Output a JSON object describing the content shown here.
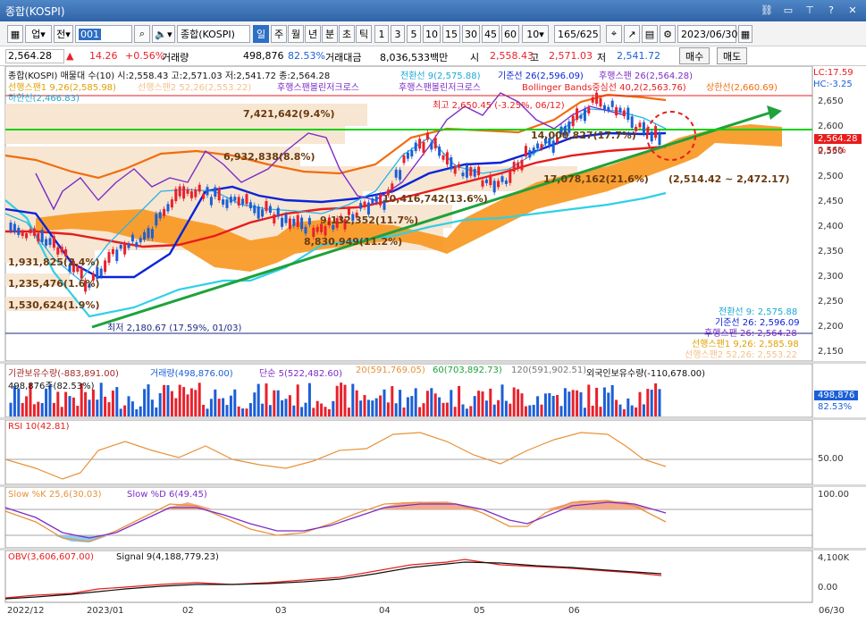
{
  "window": {
    "title": "종합(KOSPI)"
  },
  "toolbar": {
    "num_field": "0",
    "gubun1": "업",
    "gubun2": "전",
    "code": "001",
    "name": "종합(KOSPI)",
    "periods": [
      "일",
      "주",
      "월",
      "년",
      "분",
      "초",
      "틱"
    ],
    "selected_period": "일",
    "intervals": [
      "1",
      "3",
      "5",
      "10",
      "15",
      "30",
      "45",
      "60"
    ],
    "interval_value": "10",
    "count_display": "165",
    "count_total": "/625",
    "date": "2023/06/30"
  },
  "price": {
    "current": "2,564.28",
    "change": "14.26",
    "change_pct": "+0.56%",
    "volume_label": "거래량",
    "volume": "498,876",
    "volume_pct": "82.53%",
    "amount_label": "거래대금",
    "amount": "8,036,533백만",
    "open_label": "시",
    "open": "2,558.43",
    "high_label": "고",
    "high": "2,571.03",
    "low_label": "저",
    "low": "2,541.72",
    "buy": "매수",
    "sell": "매도"
  },
  "main_legend": {
    "line1a": "종합(KOSPI) 매물대 수(10)  시:2,558.43 고:2,571.03 저:2,541.72 종:2,564.28",
    "line1b": "전환선 9(2,575.88)",
    "line1c": "기준선 26(2,596.09)",
    "line1d": "후행스팬 26(2,564.28)",
    "line2a": "선행스팬1 9,26(2,585.98)",
    "line2b": "선행스팬2 52,26(2,553.22)",
    "line2c": "후행스팬볼린저크로스",
    "line2d": "후행스팬볼린저크로스",
    "line2e": "Bollinger Bands중심선 40,2(2,563.76)",
    "line2f": "상한선(2,660.69)",
    "line3": "하한선(2,466.83)",
    "lc": "LC:17.59",
    "hc": "HC:-3.25"
  },
  "annotations": {
    "vp_top": "7,421,642(9.4%)",
    "vp_2": "6,932,838(8.8%)",
    "vp_3": "10,416,742(13.6%)",
    "vp_4": "9,132,352(11.7%)",
    "vp_5": "8,830,949(11.2%)",
    "vp_6": "1,931,825(2.4%)",
    "vp_7": "1,235,476(1.6%)",
    "vp_8": "1,530,624(1.9%)",
    "vp_9": "14,000,827(17.7%)",
    "vp_10": "17,078,162(21.6%)",
    "vp_range": "(2,514.42 ~ 2,472.17)",
    "high": "최고 2,650.45 (-3.25%, 06/12)",
    "low": "최저 2,180.67 (17.59%, 01/03)"
  },
  "right_legend": {
    "a": "전환선 9: 2,575.88",
    "b": "기준선 26: 2,596.09",
    "c": "후행스팬 26: 2,564.28",
    "d": "선행스팬1 9,26: 2,585.98",
    "e": "선행스팬2 52,26: 2,553.22"
  },
  "yaxis": [
    "2,650",
    "2,600",
    "2,550",
    "2,500",
    "2,450",
    "2,400",
    "2,350",
    "2,300",
    "2,250",
    "2,200",
    "2,150"
  ],
  "y_current_tag": "2,564.28",
  "y_current_pct": "0.56%",
  "volume_panel": {
    "legend_a": "기관보유수량(-883,891.00)",
    "legend_b": "거래량(498,876.00)",
    "legend_c": "단순 5(522,482.60)",
    "legend_d": "20(591,769.05)",
    "legend_e": "60(703,892.73)",
    "legend_f": "120(591,902.51)",
    "legend_g": "외국인보유수량(-110,678.00)",
    "sub": "498,876주(82.53%)",
    "tag": "498,876",
    "tag_pct": "82.53%"
  },
  "rsi_panel": {
    "legend": "RSI 10(42.81)",
    "axis": "50.00"
  },
  "stoch_panel": {
    "legend_a": "Slow %K 25,6(30.03)",
    "legend_b": "Slow %D 6(49.45)",
    "axis": "100.00"
  },
  "obv_panel": {
    "legend_a": "OBV(3,606,607.00)",
    "legend_b": "Signal 9(4,188,779.23)",
    "axis_a": "4,100K",
    "axis_b": "0.00"
  },
  "xaxis": [
    "2022/12",
    "2023/01",
    "02",
    "03",
    "04",
    "05",
    "06",
    "06/30"
  ],
  "colors": {
    "up": "#e8212b",
    "down": "#1b5fd6",
    "accent": "#2d6fc4"
  }
}
